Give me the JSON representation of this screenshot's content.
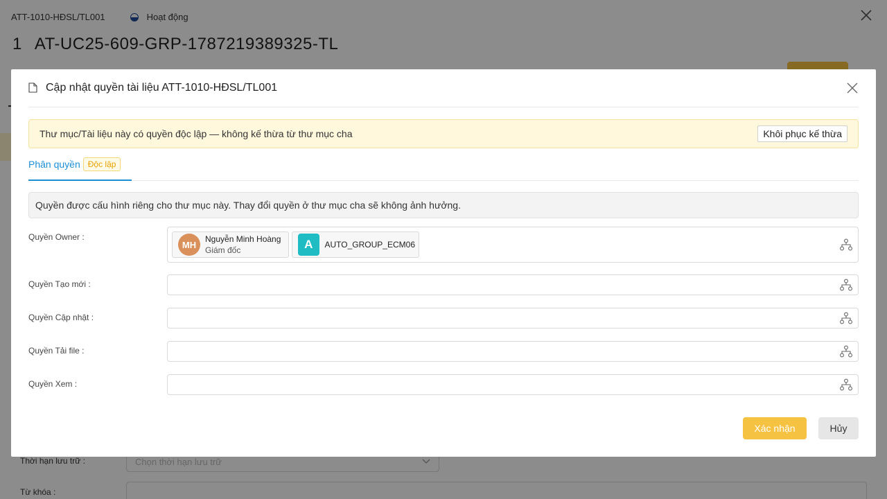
{
  "background": {
    "doc_code": "ATT-1010-HĐSL/TL001",
    "status": "Hoạt động",
    "title_index": "1",
    "title": "AT-UC25-609-GRP-1787219389325-TL",
    "retention_label": "Thời hạn lưu trữ :",
    "retention_placeholder": "Chọn thời hạn lưu trữ",
    "keyword_label": "Từ khóa :"
  },
  "modal": {
    "title": "Cập nhật quyền tài liệu ATT-1010-HĐSL/TL001",
    "notice": "Thư mục/Tài liệu này có quyền độc lập — không kế thừa từ thư mục cha",
    "restore_button": "Khôi phục kế thừa",
    "tab_label": "Phân quyền",
    "tab_badge": "Độc lập",
    "info": "Quyền được cấu hình riêng cho thư mục này. Thay đổi quyền ở thư mục cha sẽ không ảnh hưởng.",
    "permissions": {
      "owner": {
        "label": "Quyền Owner :",
        "members": [
          {
            "initials": "MH",
            "name": "Nguyễn Minh Hoàng",
            "role": "Giám đốc"
          },
          {
            "initials": "A",
            "name": "AUTO_GROUP_ECM06"
          }
        ]
      },
      "create": {
        "label": "Quyền Tạo mới :"
      },
      "update": {
        "label": "Quyền Cập nhật :"
      },
      "download": {
        "label": "Quyền Tải file :"
      },
      "view": {
        "label": "Quyền Xem :"
      }
    },
    "confirm_button": "Xác nhận",
    "cancel_button": "Hủy"
  },
  "colors": {
    "accent": "#1a8fd6",
    "primary_button": "#f5c242",
    "avatar_person": "#d9905a",
    "avatar_group": "#1fbcc4",
    "notice_bg": "#fff8dc"
  },
  "icons": {
    "close": "close-icon",
    "document": "document-icon",
    "org_tree": "org-tree-icon",
    "chevron": "chevron-down-icon"
  }
}
